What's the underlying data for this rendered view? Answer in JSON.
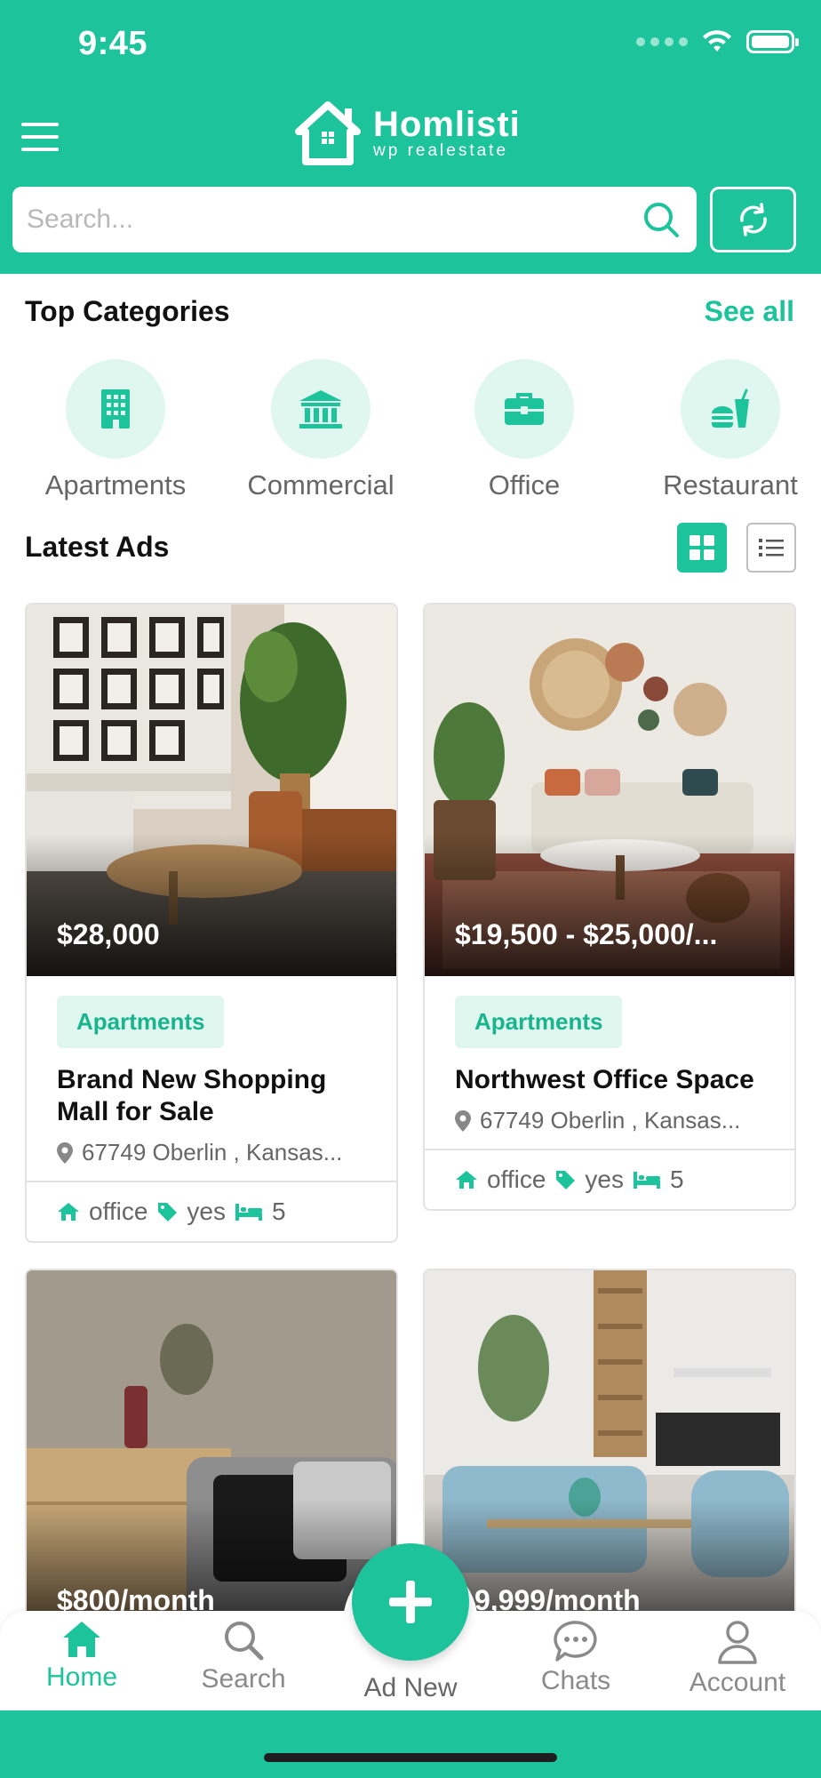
{
  "status_bar": {
    "time": "9:45"
  },
  "header": {
    "app_name": "Homlisti",
    "app_subtitle": "wp realestate",
    "search_placeholder": "Search..."
  },
  "top_categories": {
    "title": "Top Categories",
    "see_all": "See all",
    "items": [
      {
        "label": "Apartments",
        "icon": "building-icon"
      },
      {
        "label": "Commercial",
        "icon": "bank-icon"
      },
      {
        "label": "Office",
        "icon": "briefcase-icon"
      },
      {
        "label": "Restaurant",
        "icon": "fast-food-icon"
      }
    ]
  },
  "latest_ads": {
    "title": "Latest Ads",
    "view_mode": "grid",
    "cards": [
      {
        "price": "$28,000",
        "category": "Apartments",
        "title": "Brand New Shopping Mall for Sale",
        "location": "67749 Oberlin , Kansas...",
        "type": "office",
        "tag": "yes",
        "beds": "5"
      },
      {
        "price": "$19,500 - $25,000/...",
        "category": "Apartments",
        "title": "Northwest Office Space",
        "location": "67749 Oberlin , Kansas...",
        "type": "office",
        "tag": "yes",
        "beds": "5"
      },
      {
        "price": "$800/month"
      },
      {
        "price": "9,999/month"
      }
    ]
  },
  "bottom_nav": {
    "items": [
      {
        "label": "Home",
        "active": true
      },
      {
        "label": "Search",
        "active": false
      },
      {
        "label": "Ad New",
        "active": false
      },
      {
        "label": "Chats",
        "active": false
      },
      {
        "label": "Account",
        "active": false
      }
    ]
  },
  "colors": {
    "brand": "#1cc39b",
    "brand_light": "#dff7ef",
    "text": "#111111",
    "muted": "#666666"
  }
}
